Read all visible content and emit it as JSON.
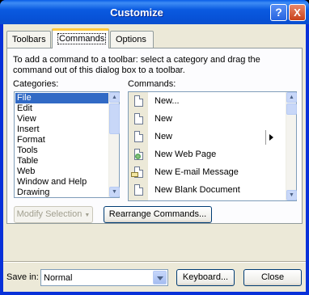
{
  "window": {
    "title": "Customize",
    "help_label": "?",
    "close_label": "X"
  },
  "tabs": [
    {
      "label": "Toolbars",
      "active": false
    },
    {
      "label": "Commands",
      "active": true
    },
    {
      "label": "Options",
      "active": false
    }
  ],
  "instructions": "To add a command to a toolbar: select a category and drag the command out of this dialog box to a toolbar.",
  "categories": {
    "label": "Categories:",
    "items": [
      "File",
      "Edit",
      "View",
      "Insert",
      "Format",
      "Tools",
      "Table",
      "Web",
      "Window and Help",
      "Drawing"
    ],
    "selected": "File"
  },
  "commands": {
    "label": "Commands:",
    "items": [
      {
        "text": "New...",
        "icon": "new-document-icon"
      },
      {
        "text": "New",
        "icon": "new-document-icon"
      },
      {
        "text": "New",
        "icon": "new-document-icon",
        "submenu": true
      },
      {
        "text": "New Web Page",
        "icon": "new-web-page-icon"
      },
      {
        "text": "New E-mail Message",
        "icon": "new-email-message-icon"
      },
      {
        "text": "New Blank Document",
        "icon": "new-document-icon"
      }
    ]
  },
  "buttons": {
    "modify_selection": "Modify Selection",
    "rearrange_commands": "Rearrange Commands...",
    "keyboard": "Keyboard...",
    "close": "Close"
  },
  "save_in": {
    "label": "Save in:",
    "value": "Normal"
  },
  "colors": {
    "titlebar": "#0a5ae0",
    "selection": "#316ac5",
    "active_tab_accent": "#ffc83c",
    "dialog_face": "#ece9d8"
  }
}
